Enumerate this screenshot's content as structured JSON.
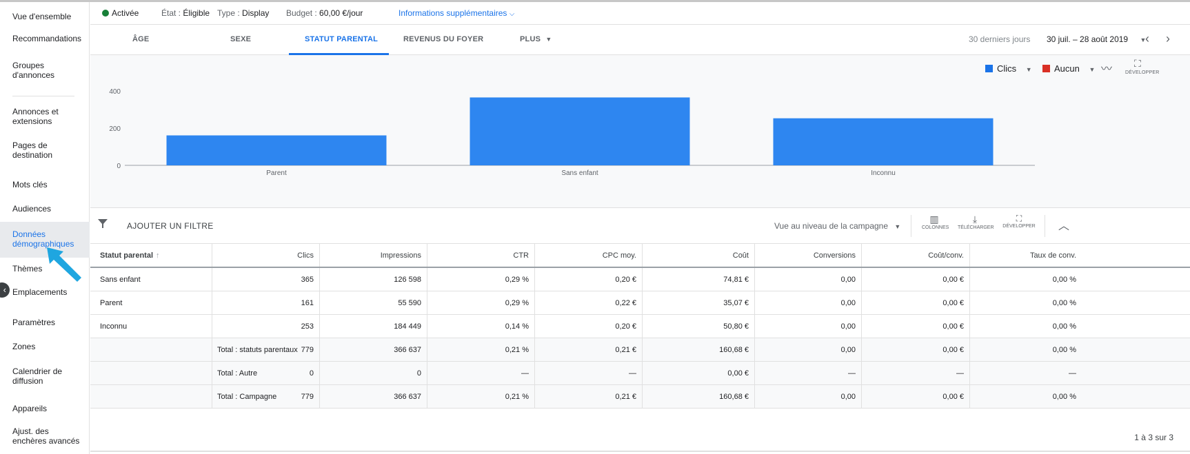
{
  "sidebar": {
    "items": [
      {
        "label": "Vue d'ensemble"
      },
      {
        "label": "Recommandations"
      },
      {
        "label": "Groupes d'annonces"
      },
      {
        "label": "Annonces et extensions"
      },
      {
        "label": "Pages de destination"
      },
      {
        "label": "Mots clés"
      },
      {
        "label": "Audiences"
      },
      {
        "label": "Données démographiques",
        "active": true
      },
      {
        "label": "Thèmes"
      },
      {
        "label": "Emplacements"
      },
      {
        "label": "Paramètres"
      },
      {
        "label": "Zones"
      },
      {
        "label": "Calendrier de diffusion"
      },
      {
        "label": "Appareils"
      },
      {
        "label": "Ajust. des enchères avancés"
      }
    ]
  },
  "status": {
    "state": "Activée",
    "eligibility_label": "État :",
    "eligibility_value": "Éligible",
    "type_label": "Type :",
    "type_value": "Display",
    "budget_label": "Budget :",
    "budget_value": "60,00 €/jour",
    "more_info": "Informations supplémentaires",
    "state_color": "#188038"
  },
  "tabs": {
    "items": [
      "ÂGE",
      "SEXE",
      "STATUT PARENTAL",
      "REVENUS DU FOYER",
      "PLUS"
    ],
    "active": "STATUT PARENTAL",
    "date_range_label": "30 derniers jours",
    "date_range_value": "30 juil. – 28 août 2019"
  },
  "chart_controls": {
    "metric1": "Clics",
    "metric1_color": "#1a73e8",
    "metric2": "Aucun",
    "metric2_color": "#d93025",
    "expand_label": "DÉVELOPPER"
  },
  "chart_data": {
    "type": "bar",
    "categories": [
      "Parent",
      "Sans enfant",
      "Inconnu"
    ],
    "values": [
      161,
      365,
      253
    ],
    "yticks": [
      0,
      200,
      400
    ],
    "ylim": [
      0,
      400
    ],
    "bar_color": "#2e86f0",
    "grid": false
  },
  "filterbar": {
    "add_filter": "AJOUTER UN FILTRE",
    "view_level": "Vue au niveau de la campagne",
    "columns": "COLONNES",
    "download": "TÉLÉCHARGER",
    "expand": "DÉVELOPPER"
  },
  "table": {
    "headers": [
      "Statut parental",
      "Clics",
      "Impressions",
      "CTR",
      "CPC moy.",
      "Coût",
      "Conversions",
      "Coût/conv.",
      "Taux de conv."
    ],
    "rows": [
      [
        "Sans enfant",
        "365",
        "126 598",
        "0,29 %",
        "0,20 €",
        "74,81 €",
        "0,00",
        "0,00 €",
        "0,00 %"
      ],
      [
        "Parent",
        "161",
        "55 590",
        "0,29 %",
        "0,22 €",
        "35,07 €",
        "0,00",
        "0,00 €",
        "0,00 %"
      ],
      [
        "Inconnu",
        "253",
        "184 449",
        "0,14 %",
        "0,20 €",
        "50,80 €",
        "0,00",
        "0,00 €",
        "0,00 %"
      ]
    ],
    "totals": [
      [
        "Total : statuts parentaux",
        "779",
        "366 637",
        "0,21 %",
        "0,21 €",
        "160,68 €",
        "0,00",
        "0,00 €",
        "0,00 %"
      ],
      [
        "Total : Autre",
        "0",
        "0",
        "—",
        "—",
        "0,00 €",
        "—",
        "—",
        "—"
      ],
      [
        "Total : Campagne",
        "779",
        "366 637",
        "0,21 %",
        "0,21 €",
        "160,68 €",
        "0,00",
        "0,00 €",
        "0,00 %"
      ]
    ],
    "pagination": "1 à 3 sur 3"
  }
}
